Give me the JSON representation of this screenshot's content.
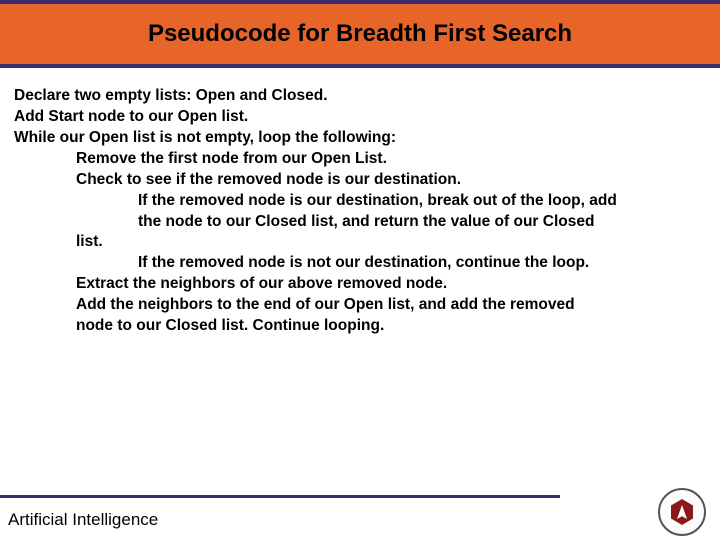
{
  "title": "Pseudocode for Breadth First Search",
  "lines": [
    {
      "indent": 0,
      "text": "Declare two empty lists: Open and Closed."
    },
    {
      "indent": 0,
      "text": "Add Start node to our Open list."
    },
    {
      "indent": 0,
      "text": "While our Open list is not empty, loop the following:"
    },
    {
      "indent": 1,
      "text": "Remove the first node from our Open List."
    },
    {
      "indent": 1,
      "text": "Check to see if the removed node is our destination."
    },
    {
      "indent": 2,
      "text": "If the removed node is our destination, break out of the loop, add"
    },
    {
      "indent": 2,
      "text": "the node to our Closed list,  and return the value of our Closed"
    },
    {
      "indent": 1,
      "text": "list."
    },
    {
      "indent": 2,
      "text": "If the removed node is not our destination, continue the loop."
    },
    {
      "indent": 1,
      "text": "Extract the neighbors of our above removed node."
    },
    {
      "indent": 1,
      "text": "Add the neighbors to the end of our Open list, and add the removed"
    },
    {
      "indent": 1,
      "text": "node to our Closed list. Continue looping."
    }
  ],
  "footer": "Artificial Intelligence"
}
